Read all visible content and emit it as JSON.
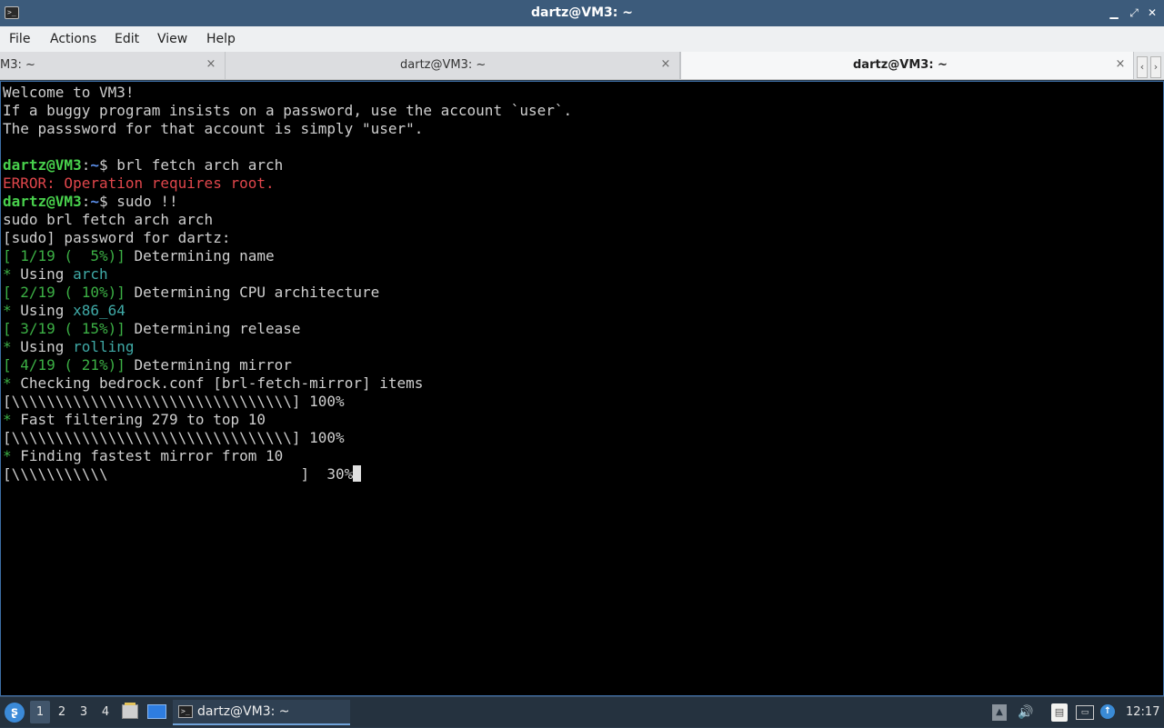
{
  "window": {
    "title": "dartz@VM3: ~",
    "app_icon": "terminal-icon",
    "controls": {
      "minimize": "▁",
      "maximize": "⤢",
      "close": "✕"
    }
  },
  "menu": [
    "File",
    "Actions",
    "Edit",
    "View",
    "Help"
  ],
  "tabs": [
    {
      "label": "M3: ~",
      "close": "×",
      "active": false
    },
    {
      "label": "dartz@VM3: ~",
      "close": "×",
      "active": false
    },
    {
      "label": "dartz@VM3: ~",
      "close": "×",
      "active": true
    }
  ],
  "tab_scroll": {
    "left": "‹",
    "right": "›"
  },
  "terminal": {
    "lines": [
      [
        {
          "t": "Welcome to VM3!"
        }
      ],
      [
        {
          "t": "If a buggy program insists on a password, use the account `user`."
        }
      ],
      [
        {
          "t": "The passsword for that account is simply \"user\"."
        }
      ],
      [
        {
          "t": ""
        }
      ],
      [
        {
          "t": "dartz@VM3",
          "c": "green"
        },
        {
          "t": ":"
        },
        {
          "t": "~",
          "c": "blue"
        },
        {
          "t": "$ brl fetch arch arch"
        }
      ],
      [
        {
          "t": "ERROR: Operation requires root.",
          "c": "red"
        }
      ],
      [
        {
          "t": "dartz@VM3",
          "c": "green"
        },
        {
          "t": ":"
        },
        {
          "t": "~",
          "c": "blue"
        },
        {
          "t": "$ sudo !!"
        }
      ],
      [
        {
          "t": "sudo brl fetch arch arch"
        }
      ],
      [
        {
          "t": "[sudo] password for dartz:"
        }
      ],
      [
        {
          "t": "[ 1/19 (  5%)]",
          "c": "green2"
        },
        {
          "t": " Determining name"
        }
      ],
      [
        {
          "t": "*",
          "c": "green2"
        },
        {
          "t": " Using "
        },
        {
          "t": "arch",
          "c": "cyan"
        }
      ],
      [
        {
          "t": "[ 2/19 ( 10%)]",
          "c": "green2"
        },
        {
          "t": " Determining CPU architecture"
        }
      ],
      [
        {
          "t": "*",
          "c": "green2"
        },
        {
          "t": " Using "
        },
        {
          "t": "x86_64",
          "c": "cyan"
        }
      ],
      [
        {
          "t": "[ 3/19 ( 15%)]",
          "c": "green2"
        },
        {
          "t": " Determining release"
        }
      ],
      [
        {
          "t": "*",
          "c": "green2"
        },
        {
          "t": " Using "
        },
        {
          "t": "rolling",
          "c": "cyan"
        }
      ],
      [
        {
          "t": "[ 4/19 ( 21%)]",
          "c": "green2"
        },
        {
          "t": " Determining mirror"
        }
      ],
      [
        {
          "t": "*",
          "c": "green2"
        },
        {
          "t": " Checking bedrock.conf [brl-fetch-mirror] items"
        }
      ],
      [
        {
          "t": "[\\\\\\\\\\\\\\\\\\\\\\\\\\\\\\\\\\\\\\\\\\\\\\\\\\\\\\\\\\\\\\\\] 100%"
        }
      ],
      [
        {
          "t": "*",
          "c": "green2"
        },
        {
          "t": " Fast filtering 279 to top 10"
        }
      ],
      [
        {
          "t": "[\\\\\\\\\\\\\\\\\\\\\\\\\\\\\\\\\\\\\\\\\\\\\\\\\\\\\\\\\\\\\\\\] 100%"
        }
      ],
      [
        {
          "t": "*",
          "c": "green2"
        },
        {
          "t": " Finding fastest mirror from 10"
        }
      ],
      [
        {
          "t": "[\\\\\\\\\\\\\\\\\\\\\\                      ]  30%"
        },
        {
          "cursor": true
        }
      ]
    ]
  },
  "taskbar": {
    "start_icon": "bedrock-start-icon",
    "start_glyph": "ʂ",
    "workspaces": [
      "1",
      "2",
      "3",
      "4"
    ],
    "active_workspace": 0,
    "task_label": "dartz@VM3: ~",
    "tray": {
      "up": "▲",
      "volume": "🔊",
      "clipboard": "▤",
      "network": "▭",
      "update": "↑"
    },
    "clock": "12:17"
  }
}
